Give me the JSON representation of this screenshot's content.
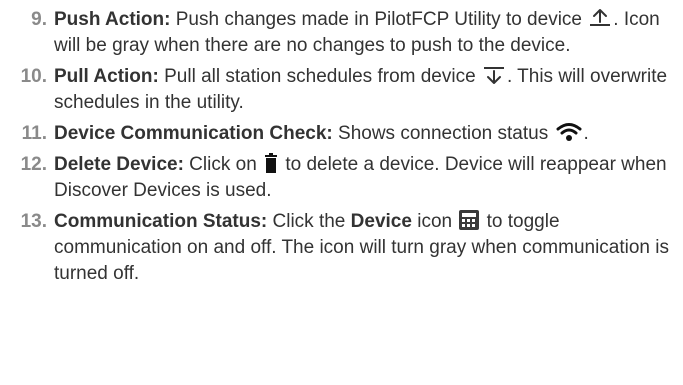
{
  "colors": {
    "text": "#333333",
    "number": "#8a8a8a"
  },
  "items": [
    {
      "number": "9.",
      "term": "Push Action:",
      "text_before": " Push changes made in PilotFCP Utility to device ",
      "icon": "push-upload-icon",
      "text_after": ". Icon will be gray when there are no changes to push to the device."
    },
    {
      "number": "10.",
      "term": "Pull Action:",
      "text_before": " Pull all station schedules from device ",
      "icon": "pull-download-icon",
      "text_after": ". This will overwrite schedules in the utility."
    },
    {
      "number": "11.",
      "term": "Device Communication Check:",
      "text_before": " Shows connection status ",
      "icon": "wifi-icon",
      "text_after": "."
    },
    {
      "number": "12.",
      "term": "Delete Device:",
      "text_before": " Click on ",
      "icon": "trash-icon",
      "text_after": " to delete a device. Device will reappear when Discover Devices is used."
    },
    {
      "number": "13.",
      "term": "Communication Status:",
      "text_before": " Click the ",
      "emphasis": "Device",
      "text_middle": " icon ",
      "icon": "device-calculator-icon",
      "text_after": " to toggle communication on and off. The icon will turn gray when communication is turned off."
    }
  ]
}
